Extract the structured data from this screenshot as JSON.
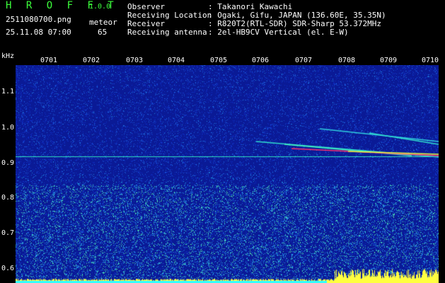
{
  "header": {
    "brand": "H R O F F T",
    "version": "1.0.0",
    "filename": "2511080700.png",
    "meteor_label": "meteor",
    "datetime": "25.11.08 07:00",
    "meteor_count": "65"
  },
  "info": [
    {
      "label": "Observer",
      "value": ": Takanori Kawachi"
    },
    {
      "label": "Receiving Location",
      "value": ": Ogaki, Gifu, JAPAN (136.60E, 35.35N)"
    },
    {
      "label": "Receiver",
      "value": ": R820T2(RTL-SDR) SDR-Sharp 53.372MHz"
    },
    {
      "label": "Receiving antenna",
      "value": ": 2el-HB9CV Vertical (el. E-W)"
    }
  ],
  "axis": {
    "y_unit": "kHz",
    "y_ticks": [
      "1.1",
      "1.0",
      "0.9",
      "0.8",
      "0.7",
      "0.6"
    ],
    "x_ticks": [
      "0701",
      "0702",
      "0703",
      "0704",
      "0705",
      "0706",
      "0707",
      "0708",
      "0709",
      "0710"
    ]
  },
  "colors": {
    "background": "#000000",
    "plot_noise": "#0a1ea0",
    "header_green": "#3cff3c",
    "signal_line": "#00ffcc",
    "echo_hot": "#ff2060",
    "baseline_yellow": "#ffff40"
  }
}
